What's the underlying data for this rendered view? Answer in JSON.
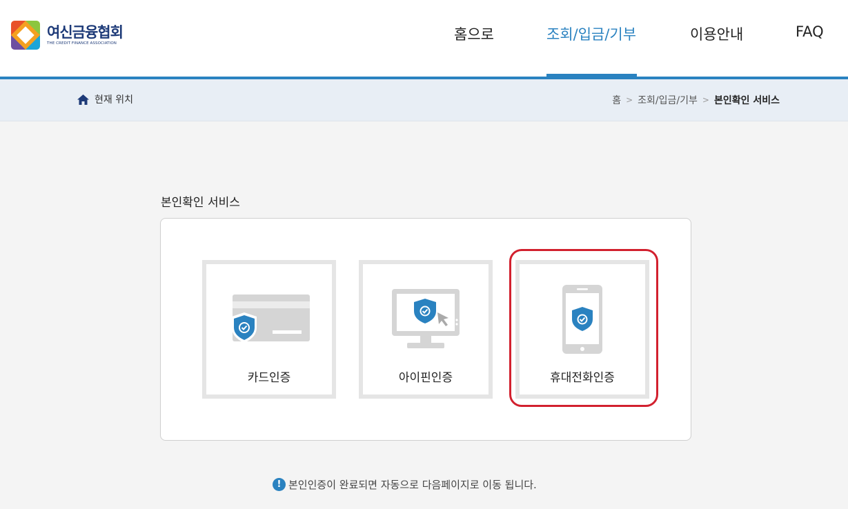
{
  "header": {
    "logo_name": "여신금융협회",
    "logo_sub": "THE CREDIT FINANCE ASSOCIATION",
    "nav": [
      {
        "label": "홈으로"
      },
      {
        "label": "조회/입금/기부",
        "active": true
      },
      {
        "label": "이용안내"
      },
      {
        "label": "FAQ"
      }
    ]
  },
  "breadcrumb": {
    "location_label": "현재 위치",
    "items": [
      "홈",
      "조회/입금/기부",
      "본인확인 서비스"
    ]
  },
  "main": {
    "section_title": "본인확인 서비스",
    "options": [
      {
        "label": "카드인증",
        "icon": "card-shield-icon"
      },
      {
        "label": "아이핀인증",
        "icon": "monitor-shield-icon"
      },
      {
        "label": "휴대전화인증",
        "icon": "phone-shield-icon",
        "highlighted": true
      }
    ],
    "notice": "본인인증이 완료되면 자동으로 다음페이지로 이동 됩니다."
  },
  "colors": {
    "brand_blue": "#2a82c0",
    "logo_navy": "#1d3a78",
    "highlight_red": "#d2202e"
  }
}
